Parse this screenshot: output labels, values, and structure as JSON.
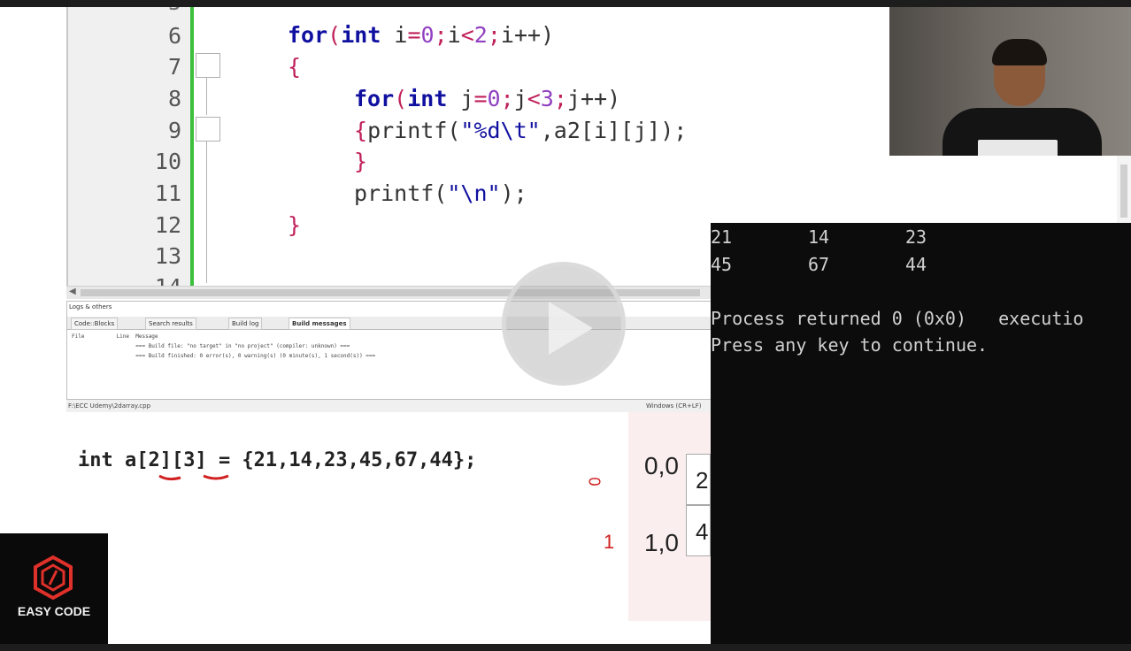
{
  "editor": {
    "line_numbers": [
      "6",
      "7",
      "8",
      "9",
      "10",
      "11",
      "12",
      "13",
      "14"
    ],
    "lines": {
      "l6": {
        "kw1": "for",
        "p1": "(",
        "kw2": "int",
        "p2": " i",
        "op1": "=",
        "n1": "0",
        "op2": ";",
        "p3": "i",
        "op3": "<",
        "n2": "2",
        "op4": ";",
        "p4": "i++)"
      },
      "l7": "{",
      "l8": {
        "kw1": "for",
        "p1": "(",
        "kw2": "int",
        "p2": " j",
        "op1": "=",
        "n1": "0",
        "op2": ";",
        "p3": "j",
        "op3": "<",
        "n2": "3",
        "op4": ";",
        "p4": "j++)"
      },
      "l9": {
        "o": "{",
        "f": "printf(",
        "s": "\"%d\\t\"",
        "r": ",a2[i][j]);"
      },
      "l10": "}",
      "l11": {
        "f": "printf(",
        "s": "\"\\n\"",
        "r": ");"
      },
      "l12": "}"
    }
  },
  "logs": {
    "title": "Logs & others",
    "tabs": [
      "Code::Blocks",
      "Search results",
      "Build log",
      "Build messages"
    ],
    "columns": "File          Line  Message",
    "line1": "                    === Build file: \"no target\" in \"no project\" (compiler: unknown) ===",
    "line2": "                    === Build finished: 0 error(s), 0 warning(s) (0 minute(s), 1 second(s)) ==="
  },
  "status": {
    "path": "F:\\ECC Udemy\\2darray.cpp",
    "encoding": "Windows (CR+LF)"
  },
  "board": {
    "code": "int a[2][3] = {21,14,23,45,67,44};",
    "row0_index": "0,0",
    "row1_index": "1,0",
    "cell0": "2",
    "cell1": "4",
    "ink_zero": "0",
    "ink_one": "1"
  },
  "logo": {
    "text": "EASY CODE"
  },
  "console": {
    "row1": [
      "21",
      "14",
      "23"
    ],
    "row2": [
      "45",
      "67",
      "44"
    ],
    "message1": "Process returned 0 (0x0)   executio",
    "message2": "Press any key to continue."
  }
}
